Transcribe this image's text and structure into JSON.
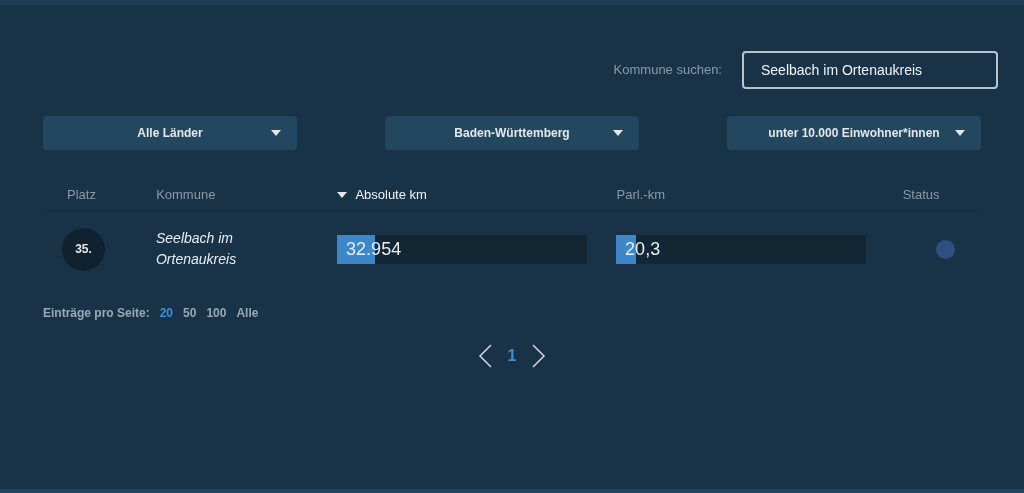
{
  "search": {
    "label": "Kommune suchen:",
    "value": "Seelbach im Ortenaukreis"
  },
  "filters": [
    {
      "label": "Alle Länder"
    },
    {
      "label": "Baden-Württemberg"
    },
    {
      "label": "unter 10.000 Einwohner*innen"
    }
  ],
  "table": {
    "columns": [
      {
        "label": "Platz",
        "sorted": false
      },
      {
        "label": "Kommune",
        "sorted": false
      },
      {
        "label": "Absolute km",
        "sorted": true
      },
      {
        "label": "Parl.-km",
        "sorted": false
      },
      {
        "label": "Status",
        "sorted": false
      }
    ],
    "rows": [
      {
        "rank": "35.",
        "name": "Seelbach im Ortenaukreis",
        "absolute": {
          "value": "32.954",
          "level": 0.15
        },
        "parl": {
          "value": "20,3",
          "level": 0.08
        },
        "color": "#2f4f80"
      }
    ]
  },
  "page_size": {
    "label": "Einträge pro Seite:",
    "options": [
      {
        "label": "20",
        "selected": true
      },
      {
        "label": "50",
        "selected": false
      },
      {
        "label": "100",
        "selected": false
      },
      {
        "label": "Alle",
        "selected": false
      }
    ]
  },
  "pagination": {
    "pages": [
      {
        "label": "1",
        "selected": true
      }
    ]
  }
}
